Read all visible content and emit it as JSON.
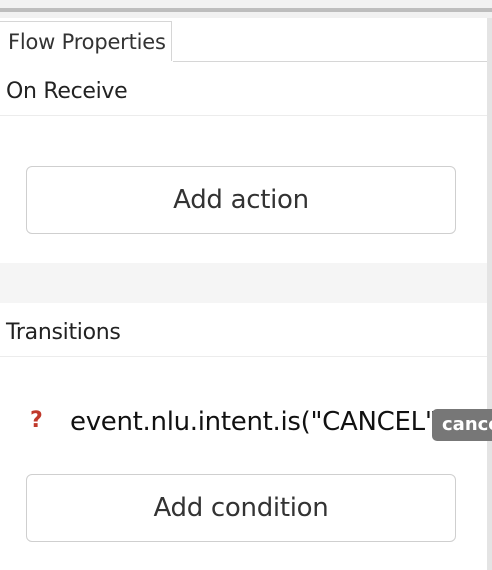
{
  "tabs": [
    {
      "label": "Flow Properties",
      "active": true
    }
  ],
  "on_receive": {
    "title": "On Receive",
    "add_action_label": "Add action"
  },
  "transitions": {
    "title": "Transitions",
    "items": [
      {
        "icon": "question-mark-icon",
        "icon_glyph": "?",
        "condition": "event.nlu.intent.is(\"CANCEL\")",
        "tag": "cance"
      }
    ],
    "add_condition_label": "Add condition"
  },
  "colors": {
    "question_icon": "#c0392b",
    "tag_background": "#777777",
    "border": "#cfcfcf"
  }
}
